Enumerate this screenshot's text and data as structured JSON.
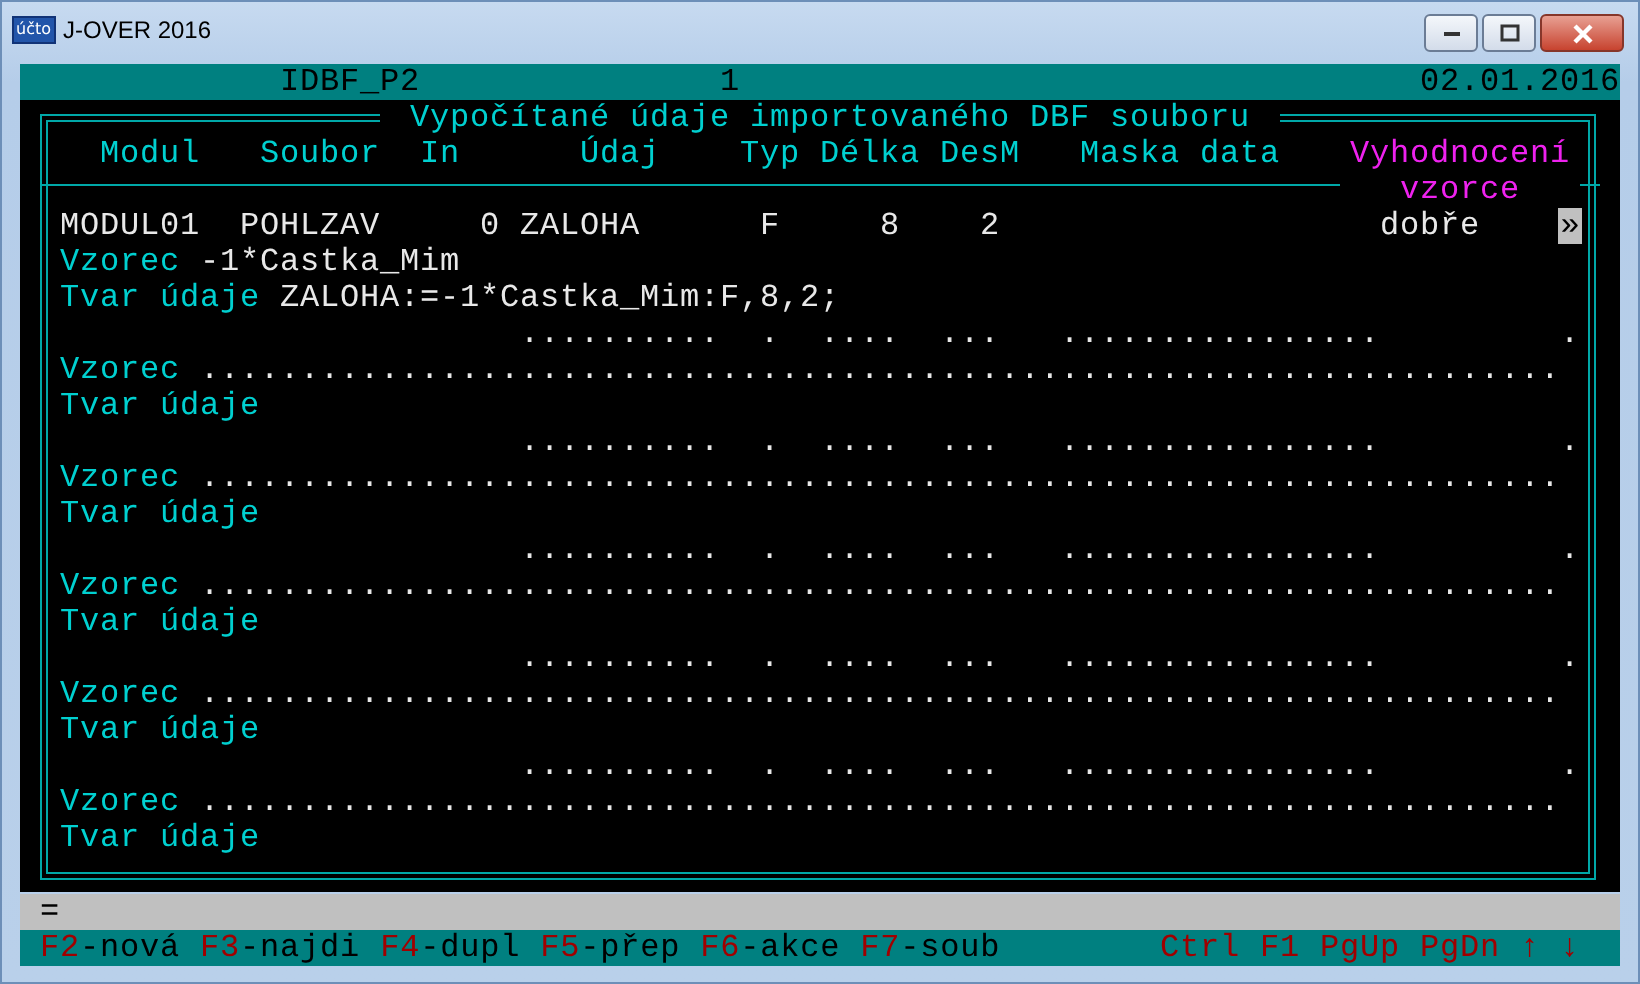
{
  "window": {
    "title": "J-OVER 2016",
    "icon_text": "účto"
  },
  "header": {
    "form": "IDBF_P2",
    "page": "1",
    "date": "02.01.2016"
  },
  "frame_title": "Vypočítané údaje importovaného DBF souboru",
  "columns": [
    {
      "label": "Modul",
      "highlighted": false
    },
    {
      "label": "Soubor",
      "highlighted": false
    },
    {
      "label": "In",
      "highlighted": false
    },
    {
      "label": "Údaj",
      "highlighted": false
    },
    {
      "label": "Typ",
      "highlighted": false
    },
    {
      "label": "Délka",
      "highlighted": false
    },
    {
      "label": "DesM",
      "highlighted": false
    },
    {
      "label": "Maska data",
      "highlighted": false
    },
    {
      "label": "Vyhodnocení vzorce",
      "highlighted": true
    }
  ],
  "records": [
    {
      "kind": "filled",
      "modul": "MODUL01",
      "soubor": "POHLZAV",
      "in": "0",
      "udaj": "ZALOHA",
      "typ": "F",
      "delka": "8",
      "desm": "2",
      "evaluation": "dobře",
      "action": "»",
      "vzorec_label": "Vzorec",
      "vzorec": "-1*Castka_Mim",
      "tvar_label": "Tvar údaje",
      "tvar": "ZALOHA:=-1*Castka_Mim:F,8,2;"
    },
    {
      "kind": "blank",
      "udaj": "..........",
      "typ": ".",
      "delka": "....",
      "desm": "...",
      "maska": "................",
      "action": ".",
      "vzorec_label": "Vzorec",
      "vzorec": "....................................................................",
      "tvar_label": "Tvar údaje"
    },
    {
      "kind": "blank",
      "udaj": "..........",
      "typ": ".",
      "delka": "....",
      "desm": "...",
      "maska": "................",
      "action": ".",
      "vzorec_label": "Vzorec",
      "vzorec": "....................................................................",
      "tvar_label": "Tvar údaje"
    },
    {
      "kind": "blank",
      "udaj": "..........",
      "typ": ".",
      "delka": "....",
      "desm": "...",
      "maska": "................",
      "action": ".",
      "vzorec_label": "Vzorec",
      "vzorec": "....................................................................",
      "tvar_label": "Tvar údaje"
    },
    {
      "kind": "blank",
      "udaj": "..........",
      "typ": ".",
      "delka": "....",
      "desm": "...",
      "maska": "................",
      "action": ".",
      "vzorec_label": "Vzorec",
      "vzorec": "....................................................................",
      "tvar_label": "Tvar údaje"
    },
    {
      "kind": "blank",
      "udaj": "..........",
      "typ": ".",
      "delka": "....",
      "desm": "...",
      "maska": "................",
      "action": ".",
      "vzorec_label": "Vzorec",
      "vzorec": "....................................................................",
      "tvar_label": "Tvar údaje"
    }
  ],
  "input_line": "=",
  "shortcuts": [
    {
      "key": "F2",
      "label": "-nová"
    },
    {
      "key": "F3",
      "label": "-najdi"
    },
    {
      "key": "F4",
      "label": "-dupl"
    },
    {
      "key": "F5",
      "label": "-přep"
    },
    {
      "key": "F6",
      "label": "-akce"
    },
    {
      "key": "F7",
      "label": "-soub"
    }
  ],
  "nav_keys": "Ctrl F1 PgUp PgDn ↑ ↓"
}
